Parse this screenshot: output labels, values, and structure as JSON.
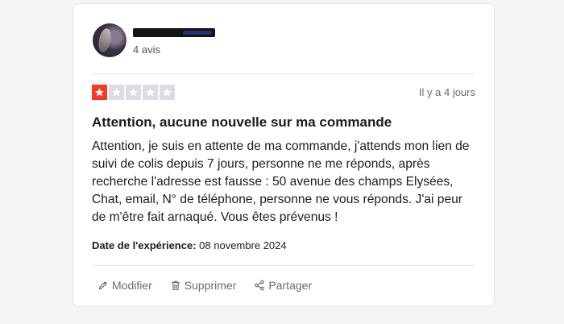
{
  "review": {
    "reviewer": {
      "review_count": "4 avis"
    },
    "rating": 1,
    "max_rating": 5,
    "date_ago": "Il y a 4 jours",
    "title": "Attention, aucune nouvelle sur ma commande",
    "body": "Attention, je suis en attente de ma commande, j'attends mon lien de suivi de colis depuis 7 jours, personne ne me réponds, après recherche l'adresse est fausse : 50 avenue des champs Elysées, Chat, email, N° de téléphone, personne ne vous réponds. J'ai peur de m'être fait arnaqué. Vous êtes prévenus !",
    "experience_label": "Date de l'expérience:",
    "experience_date": "08 novembre 2024",
    "actions": {
      "edit": "Modifier",
      "delete": "Supprimer",
      "share": "Partager"
    }
  },
  "colors": {
    "star_filled": "#ff3722",
    "star_empty": "#dcdce6",
    "muted_text": "#6b6b6b"
  },
  "icons": [
    "pencil-icon",
    "trash-icon",
    "share-icon",
    "star-icon"
  ]
}
